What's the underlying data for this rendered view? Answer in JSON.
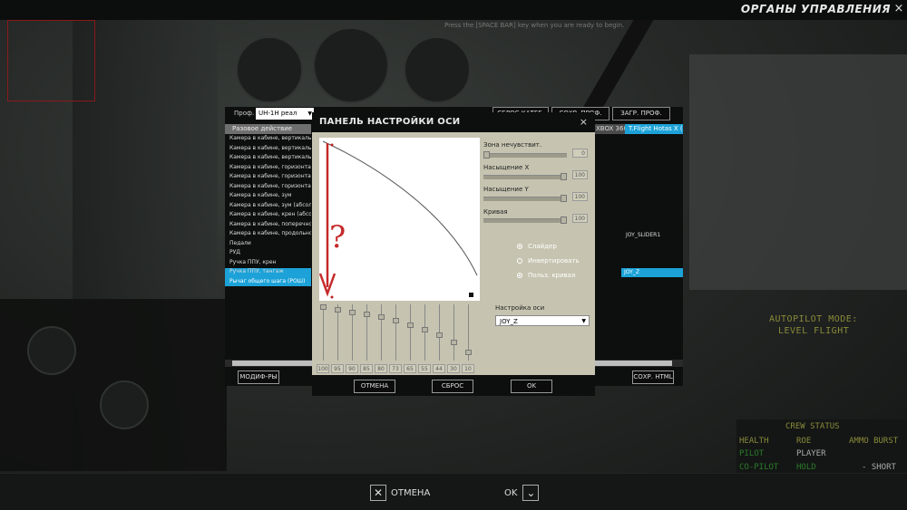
{
  "window": {
    "title": "ОРГАНЫ УПРАВЛЕНИЯ",
    "close_glyph": "×",
    "hint": "Press the [SPACE BAR] key when you are ready to begin."
  },
  "controls": {
    "prof_label": "Проф.",
    "profile": "UH-1H реал",
    "btn_reset_cat": "СБРОС КАТЕГ.",
    "btn_save_as": "СОХР. ПРОФ. КАК",
    "btn_load": "ЗАГР. ПРОФ.",
    "list_header": "Разовое действие",
    "rows": [
      "Камера в кабине, вертикаль",
      "Камера в кабине, вертикаль (абс)",
      "Камера в кабине, вертикаль",
      "Камера в кабине, горизонталь",
      "Камера в кабине, горизонталь",
      "Камера в кабине, горизонталь",
      "Камера в кабине, зум",
      "Камера в кабине, зум (абсолютный)",
      "Камера в кабине, крен (абсолютный)",
      "Камера в кабине, поперечное",
      "Камера в кабине, продольное",
      "Педали",
      "РУД",
      "Ручка ППУ, крен",
      "Ручка ППУ, тангаж",
      "Рычаг общего шага (РОШ)"
    ],
    "dev_header_a": "XBOX 360",
    "dev_header_b": "T.Flight Hotas X (",
    "dev_cell_slider": "JOY_SLIDER1",
    "dev_cell_z": "JOY_Z",
    "btn_modifiers": "МОДИФ-РЫ",
    "btn_save_html": "СОХР. HTML"
  },
  "axis_panel": {
    "title": "ПАНЕЛЬ НАСТРОЙКИ ОСИ",
    "close_glyph": "×",
    "deadzone_label": "Зона нечувствит.",
    "deadzone_value": "0",
    "satx_label": "Насыщение X",
    "satx_value": "100",
    "saty_label": "Насыщение Y",
    "saty_value": "100",
    "curve_label": "Кривая",
    "curve_value": "100",
    "opt_slider": "Слайдер",
    "opt_invert": "Инвертировать",
    "opt_user_curve": "Польз. кривая",
    "axis_setting_label": "Настройка оси",
    "axis_value": "JOY_Z",
    "curve_values": [
      "100",
      "95",
      "90",
      "85",
      "80",
      "73",
      "65",
      "55",
      "44",
      "30",
      "10"
    ],
    "btn_cancel": "ОТМЕНА",
    "btn_reset": "СБРОС",
    "btn_ok": "OK",
    "annotation": "?"
  },
  "bottom": {
    "cancel": "ОТМЕНА",
    "ok": "OK"
  },
  "hud": {
    "autopilot": "AUTOPILOT MODE:",
    "level_flight": "LEVEL FLIGHT",
    "crew_status": "CREW STATUS",
    "health": "HEALTH",
    "roe": "ROE",
    "ammo": "AMMO BURST",
    "pilot": "PILOT",
    "player": "PLAYER",
    "copilot": "CO-PILOT",
    "hold": "HOLD",
    "short": "- SHORT"
  }
}
